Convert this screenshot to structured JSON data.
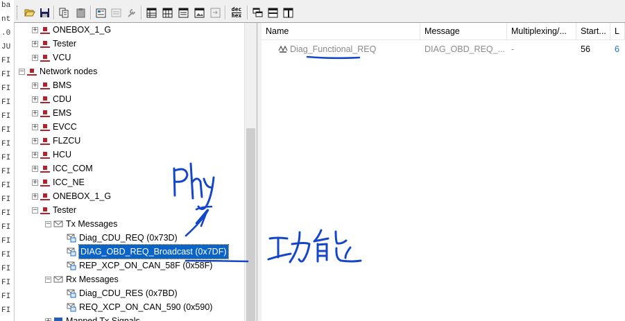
{
  "left_strip": [
    "ba",
    "nt",
    ".0",
    "JU",
    "FI",
    "FI",
    "FI",
    "FI",
    "FI",
    "FI",
    "FI",
    "FI",
    "FI",
    "FI",
    "FI",
    "FI",
    "FI",
    "FI",
    "FI",
    "FI",
    "FI",
    "FI",
    "FI"
  ],
  "toolbar": {
    "icons": [
      "open-folder-icon",
      "save-icon",
      "copy-icon",
      "paste-icon",
      "properties-icon",
      "disabled-icon",
      "tools-icon",
      "table-view-icon",
      "table-view-2-icon",
      "list-view-icon",
      "image-view-icon",
      "export-icon",
      "dec-hex-icon",
      "cascade-icon",
      "horizontal-split-icon",
      "vertical-split-icon"
    ],
    "dec_hex_top": "dec",
    "dec_hex_bottom": "hex"
  },
  "tree": {
    "rows": [
      {
        "label": "ONEBOX_1_G",
        "level": 1,
        "expander": "+",
        "icon": "node"
      },
      {
        "label": "Tester",
        "level": 1,
        "expander": "+",
        "icon": "node"
      },
      {
        "label": "VCU",
        "level": 1,
        "expander": "+",
        "icon": "node"
      },
      {
        "label": "Network nodes",
        "level": 0,
        "expander": "−",
        "icon": "node"
      },
      {
        "label": "BMS",
        "level": 1,
        "expander": "+",
        "icon": "node"
      },
      {
        "label": "CDU",
        "level": 1,
        "expander": "+",
        "icon": "node"
      },
      {
        "label": "EMS",
        "level": 1,
        "expander": "+",
        "icon": "node"
      },
      {
        "label": "EVCC",
        "level": 1,
        "expander": "+",
        "icon": "node"
      },
      {
        "label": "FLZCU",
        "level": 1,
        "expander": "+",
        "icon": "node"
      },
      {
        "label": "HCU",
        "level": 1,
        "expander": "+",
        "icon": "node"
      },
      {
        "label": "ICC_COM",
        "level": 1,
        "expander": "+",
        "icon": "node"
      },
      {
        "label": "ICC_NE",
        "level": 1,
        "expander": "+",
        "icon": "node"
      },
      {
        "label": "ONEBOX_1_G",
        "level": 1,
        "expander": "+",
        "icon": "node"
      },
      {
        "label": "Tester",
        "level": 1,
        "expander": "−",
        "icon": "node"
      },
      {
        "label": "Tx Messages",
        "level": 2,
        "expander": "−",
        "icon": "envelope"
      },
      {
        "label": "Diag_CDU_REQ (0x73D)",
        "level": 3,
        "expander": "",
        "icon": "message"
      },
      {
        "label": "DIAG_OBD_REQ_Broadcast (0x7DF)",
        "level": 3,
        "expander": "",
        "icon": "message",
        "selected": true
      },
      {
        "label": "REP_XCP_ON_CAN_58F (0x58F)",
        "level": 3,
        "expander": "",
        "icon": "message"
      },
      {
        "label": "Rx Messages",
        "level": 2,
        "expander": "−",
        "icon": "envelope"
      },
      {
        "label": "Diag_CDU_RES (0x7BD)",
        "level": 3,
        "expander": "",
        "icon": "message"
      },
      {
        "label": "REQ_XCP_ON_CAN_590 (0x590)",
        "level": 3,
        "expander": "",
        "icon": "message"
      },
      {
        "label": "Mapped Tx Signals",
        "level": 2,
        "expander": "+",
        "icon": "signal"
      }
    ]
  },
  "list": {
    "columns": [
      "Name",
      "Message",
      "Multiplexing/...",
      "Start...",
      "L"
    ],
    "rows": [
      {
        "name": "Diag_Functional_REQ",
        "message": "DIAG_OBD_REQ_...",
        "multiplexing": "-",
        "start": "56",
        "extra": "6"
      }
    ]
  },
  "annotations": {
    "phy_text": "Phy",
    "functional_text": "功能",
    "ink_color": "#1446c8"
  }
}
